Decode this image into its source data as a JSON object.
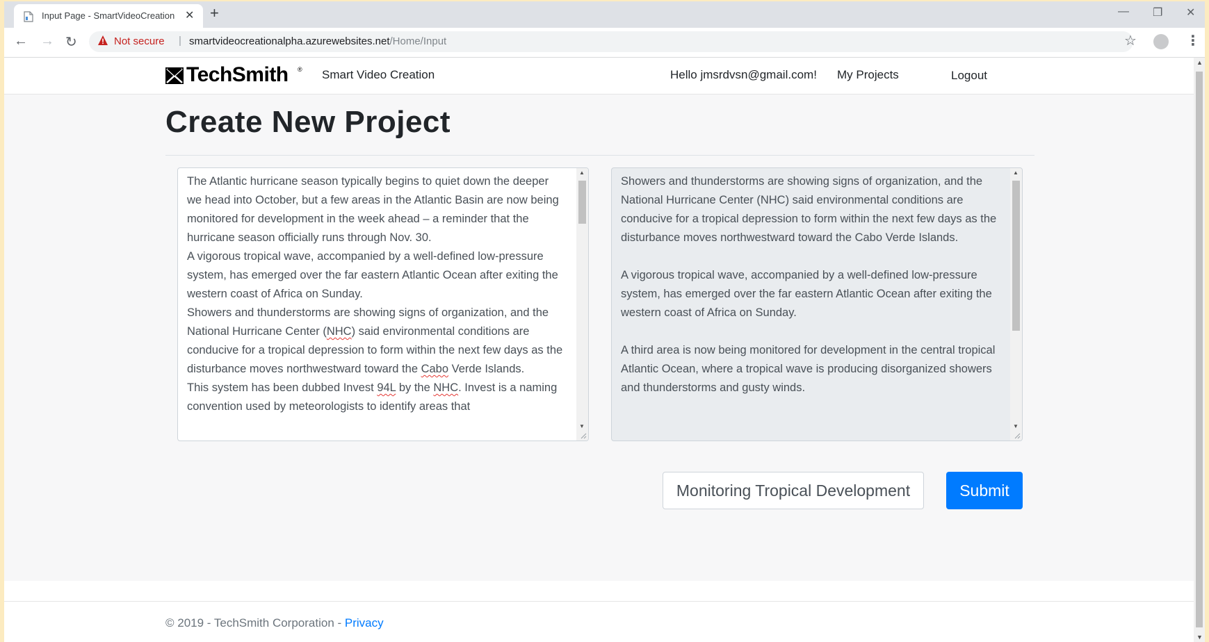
{
  "browser": {
    "tab_title": "Input Page - SmartVideoCreation",
    "not_secure_label": "Not secure",
    "url_host": "smartvideocreationalpha.azurewebsites.net",
    "url_path": "/Home/Input"
  },
  "navbar": {
    "logo_text": "TechSmith",
    "brand_link": "Smart Video Creation",
    "greeting": "Hello jmsrdvsn@gmail.com!",
    "my_projects": "My Projects",
    "logout": "Logout"
  },
  "main": {
    "title": "Create New Project",
    "input_text": {
      "p1": "The Atlantic hurricane season typically begins to quiet down the deeper we head into October, but a few areas in the Atlantic Basin are now being monitored for development in the week ahead – a reminder that the hurricane season officially runs through Nov. 30.",
      "p2": "A vigorous tropical wave, accompanied by a well-defined low-pressure system, has emerged over the far eastern Atlantic Ocean after exiting the western coast of Africa on Sunday.",
      "p3a": "Showers and thunderstorms are showing signs of organization, and the National Hurricane Center (",
      "p3b": "NHC",
      "p3c": ") said environmental conditions are conducive for a tropical depression to form within the next few days as the disturbance moves northwestward toward the ",
      "p3d": "Cabo",
      "p3e": " Verde Islands.",
      "p4a": "This system has been dubbed Invest ",
      "p4b": "94L",
      "p4c": " by the ",
      "p4d": "NHC",
      "p4e": ". Invest is a naming convention used by meteorologists to identify areas that"
    },
    "summary_paragraphs": [
      "Showers and thunderstorms are showing signs of organization, and the National Hurricane Center (NHC) said environmental conditions are conducive for a tropical depression to form within the next few days as the disturbance moves northwestward toward the Cabo Verde Islands.",
      "A vigorous tropical wave, accompanied by a well-defined low-pressure system, has emerged over the far eastern Atlantic Ocean after exiting the western coast of Africa on Sunday.",
      "A third area is now being monitored for development in the central tropical Atlantic Ocean, where a tropical wave is producing disorganized showers and thunderstorms and gusty winds."
    ],
    "project_title_value": "Monitoring Tropical Development",
    "submit_label": "Submit"
  },
  "footer": {
    "copyright": "© 2019 - TechSmith Corporation - ",
    "privacy": "Privacy"
  }
}
